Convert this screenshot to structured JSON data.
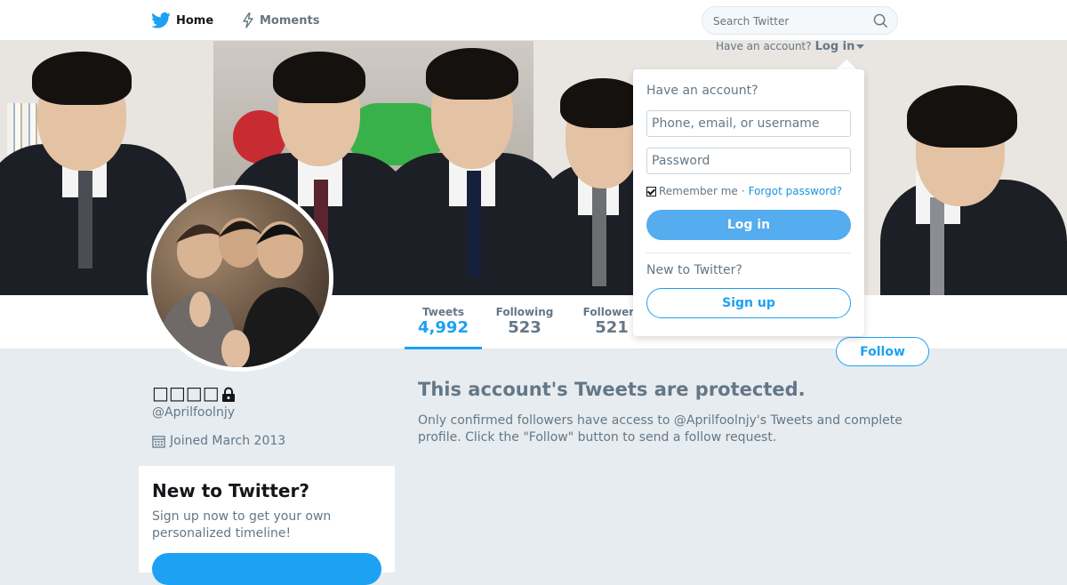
{
  "nav": {
    "home_label": "Home",
    "moments_label": "Moments",
    "search_placeholder": "Search Twitter"
  },
  "colors": {
    "accent": "#1da1f2",
    "text_secondary": "#657786",
    "page_bg": "#e6ecf0"
  },
  "profile": {
    "name": "□□□□",
    "handle": "@Aprilfoolnjy",
    "joined": "Joined March 2013"
  },
  "stats": [
    {
      "label": "Tweets",
      "value": "4,992"
    },
    {
      "label": "Following",
      "value": "523"
    },
    {
      "label": "Followers",
      "value": "521"
    }
  ],
  "follow_label": "Follow",
  "signup_card": {
    "title": "New to Twitter?",
    "text": "Sign up now to get your own personalized timeline!"
  },
  "protected": {
    "title": "This account's Tweets are protected.",
    "description": "Only confirmed followers have access to @Aprilfoolnjy's Tweets and complete profile. Click the \"Follow\" button to send a follow request."
  },
  "login_menu": {
    "prompt": "Have an account?",
    "link": "Log in",
    "title": "Have an account?",
    "username_placeholder": "Phone, email, or username",
    "password_placeholder": "Password",
    "remember": "Remember me",
    "separator": "·",
    "forgot": "Forgot password?",
    "login_button": "Log in",
    "new_prompt": "New to Twitter?",
    "signup_button": "Sign up"
  }
}
